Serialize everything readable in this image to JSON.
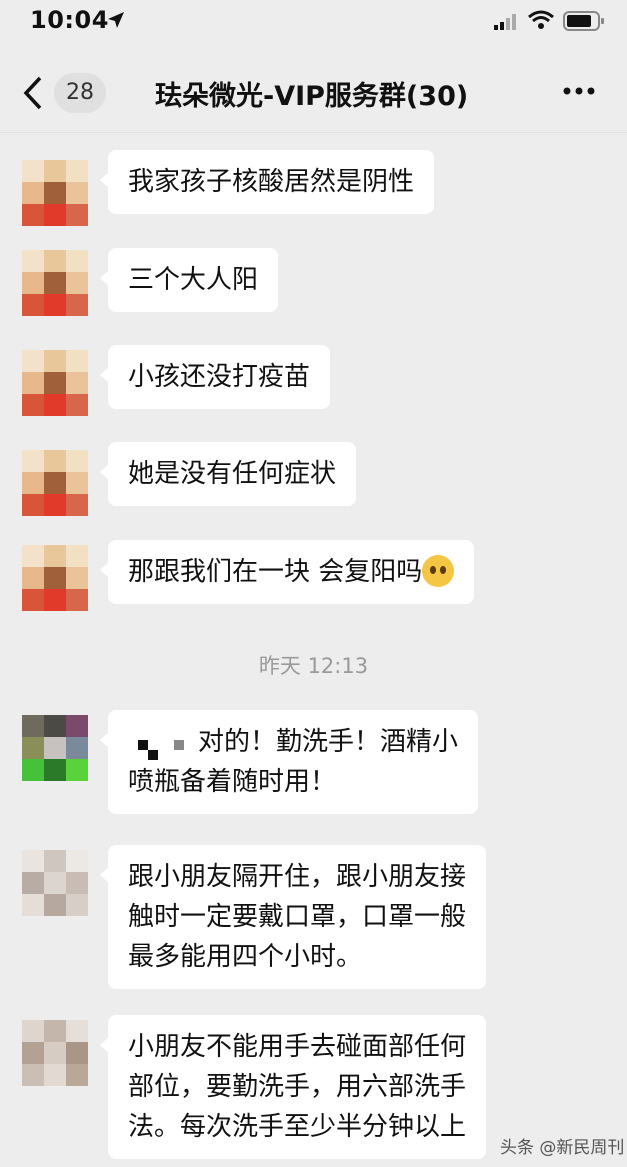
{
  "status_bar": {
    "time": "10:04"
  },
  "header": {
    "unread_count": "28",
    "title": "珐朵微光-VIP服务群(30)"
  },
  "messages": [
    {
      "text": "我家孩子核酸居然是阴性"
    },
    {
      "text": "三个大人阳"
    },
    {
      "text": "小孩还没打疫苗"
    },
    {
      "text": "她是没有任何症状"
    },
    {
      "text": "那跟我们在一块 会复阳吗"
    }
  ],
  "timestamp": "昨天 12:13",
  "later_messages": [
    {
      "line1": "对的！勤洗手！酒精小",
      "line2": "喷瓶备着随时用！"
    },
    {
      "line1": "跟小朋友隔开住，跟小朋友接",
      "line2": "触时一定要戴口罩，口罩一般",
      "line3": "最多能用四个小时。"
    },
    {
      "line1": "小朋友不能用手去碰面部任何",
      "line2": "部位，要勤洗手，用六部洗手",
      "line3": "法。每次洗手至少半分钟以上"
    }
  ],
  "watermark": "头条 @新民周刊",
  "colors": {
    "background": "#ededed",
    "bubble": "#ffffff",
    "accent": "#f5c643"
  }
}
